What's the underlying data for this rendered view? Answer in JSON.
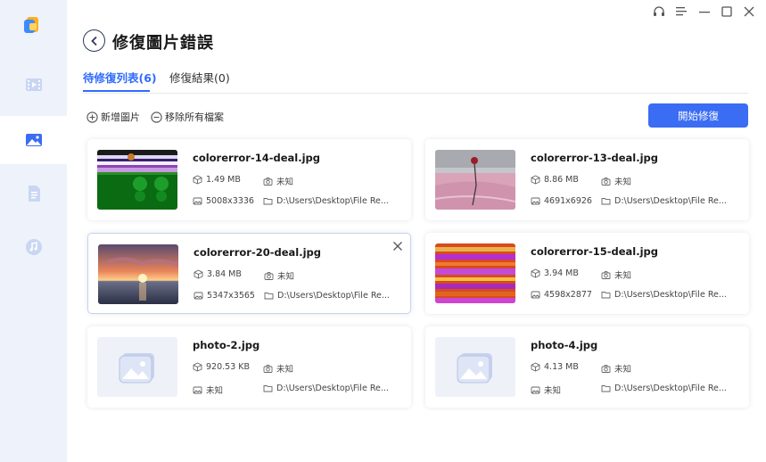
{
  "header": {
    "title": "修復圖片錯誤"
  },
  "tabs": [
    {
      "label": "待修復列表(6)"
    },
    {
      "label": "修復結果(0)"
    }
  ],
  "toolbar": {
    "add_label": "新增圖片",
    "remove_all_label": "移除所有檔案",
    "start_label": "開始修復"
  },
  "sidebar": {
    "items": [
      "video-icon",
      "image-icon",
      "document-icon",
      "music-icon"
    ],
    "active": "image-icon"
  },
  "colors": {
    "accent": "#3a6cf4",
    "sidebar_bg": "#eef2fb"
  },
  "files": [
    {
      "name": "colorerror-14-deal.jpg",
      "size": "1.49 MB",
      "camera": "未知",
      "dimensions": "5008x3336",
      "path": "D:\\Users\\Desktop\\File Re..."
    },
    {
      "name": "colorerror-13-deal.jpg",
      "size": "8.86 MB",
      "camera": "未知",
      "dimensions": "4691x6926",
      "path": "D:\\Users\\Desktop\\File Re..."
    },
    {
      "name": "colorerror-20-deal.jpg",
      "size": "3.84 MB",
      "camera": "未知",
      "dimensions": "5347x3565",
      "path": "D:\\Users\\Desktop\\File Re..."
    },
    {
      "name": "colorerror-15-deal.jpg",
      "size": "3.94 MB",
      "camera": "未知",
      "dimensions": "4598x2877",
      "path": "D:\\Users\\Desktop\\File Re..."
    },
    {
      "name": "photo-2.jpg",
      "size": "920.53 KB",
      "camera": "未知",
      "dimensions": "未知",
      "path": "D:\\Users\\Desktop\\File Re..."
    },
    {
      "name": "photo-4.jpg",
      "size": "4.13 MB",
      "camera": "未知",
      "dimensions": "未知",
      "path": "D:\\Users\\Desktop\\File Re..."
    }
  ]
}
